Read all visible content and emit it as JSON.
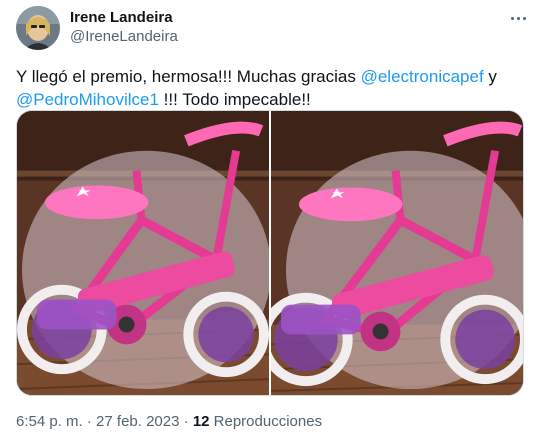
{
  "user": {
    "display_name": "Irene Landeira",
    "handle": "@IreneLandeira"
  },
  "tweet": {
    "text_parts": {
      "t1": "Y llegó el premio, hermosa!!! Muchas gracias ",
      "m1": "@electronicapef",
      "t2": " y ",
      "m2": "@PedroMihovilce1",
      "t3": " !!! Todo impecable!!"
    }
  },
  "meta": {
    "time": "6:54 p. m.",
    "sep1": " · ",
    "date": "27 feb. 2023",
    "sep2": " · ",
    "views_count": "12",
    "views_label": " Reproducciones"
  },
  "colors": {
    "link": "#1d9bf0",
    "muted": "#536471"
  },
  "icons": {
    "more": "more-options-icon"
  }
}
